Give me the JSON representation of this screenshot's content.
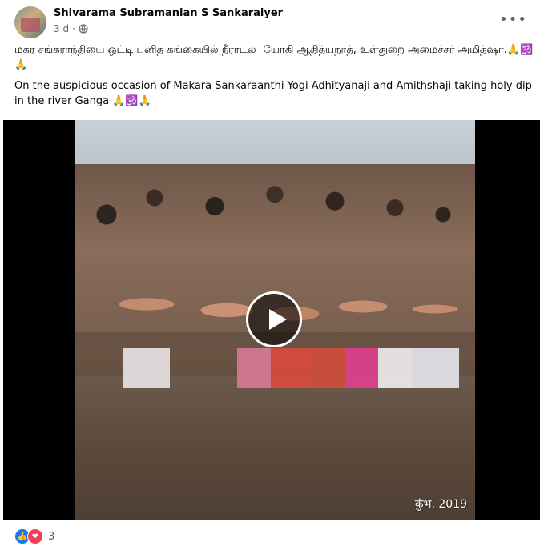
{
  "post": {
    "author": "Shivarama Subramanian S Sankaraiyer",
    "time": "3 d",
    "dot": "·",
    "more": "•••",
    "caption_tamil": "மகர சங்கராந்தியை ஒட்டி புனித கங்கையில் நீராடல்  -யோகி ஆதித்யநாத், உள்துறை அமைச்சர் அமித்ஷா.🙏🕉️🙏",
    "caption_english": "On the auspicious occasion of Makara Sankaraanthi Yogi Adhityanaji and Amithshaji taking holy dip in the river Ganga 🙏🕉️🙏"
  },
  "video": {
    "watermark": "कुंभ, 2019"
  },
  "reactions": {
    "like_icon": "👍",
    "love_icon": "❤",
    "count": "3"
  },
  "colors": {
    "text_primary": "#050505",
    "text_secondary": "#65676b",
    "like": "#1877f2",
    "love": "#f33e58"
  }
}
